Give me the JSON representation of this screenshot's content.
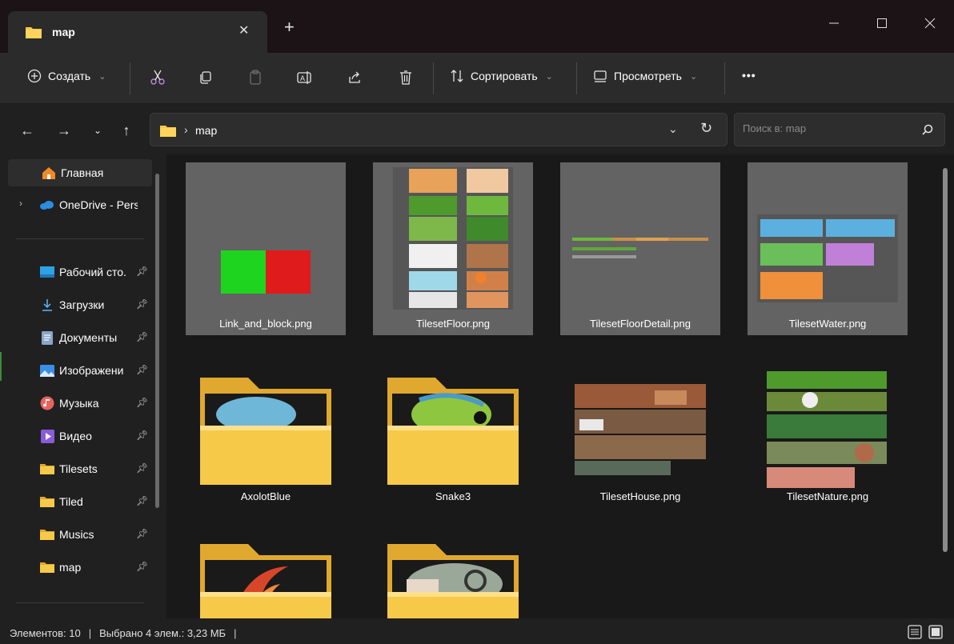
{
  "window": {
    "tab_title": "map",
    "tab_close_icon": "close-icon",
    "new_tab_symbol": "+",
    "controls": [
      "minimize",
      "maximize",
      "close"
    ]
  },
  "toolbar": {
    "create_label": "Создать",
    "sort_label": "Сортировать",
    "view_label": "Просмотреть",
    "more_label": "•••",
    "icons": [
      "cut-icon",
      "copy-icon",
      "paste-icon",
      "rename-icon",
      "share-icon",
      "delete-icon"
    ]
  },
  "address": {
    "crumb": "map",
    "separator": "›"
  },
  "search": {
    "placeholder": "Поиск в: map"
  },
  "sidebar": {
    "items": [
      {
        "label": "Главная",
        "icon": "home-icon",
        "pinned": false
      },
      {
        "label": "OneDrive - Persc",
        "icon": "onedrive-icon",
        "pinned": false
      },
      {
        "label": "Рабочий сто.",
        "icon": "desktop-icon",
        "pinned": true
      },
      {
        "label": "Загрузки",
        "icon": "download-icon",
        "pinned": true
      },
      {
        "label": "Документы",
        "icon": "documents-icon",
        "pinned": true
      },
      {
        "label": "Изображени",
        "icon": "pictures-icon",
        "pinned": true
      },
      {
        "label": "Музыка",
        "icon": "music-icon",
        "pinned": true
      },
      {
        "label": "Видео",
        "icon": "video-icon",
        "pinned": true
      },
      {
        "label": "Tilesets",
        "icon": "folder-icon",
        "pinned": true
      },
      {
        "label": "Tiled",
        "icon": "folder-icon",
        "pinned": true
      },
      {
        "label": "Musics",
        "icon": "folder-icon",
        "pinned": true
      },
      {
        "label": "map",
        "icon": "folder-icon",
        "pinned": true
      }
    ]
  },
  "files": [
    {
      "name": "Link_and_block.png",
      "kind": "image",
      "selected": true
    },
    {
      "name": "TilesetFloor.png",
      "kind": "image",
      "selected": true
    },
    {
      "name": "TilesetFloorDetail.png",
      "kind": "image",
      "selected": true
    },
    {
      "name": "TilesetWater.png",
      "kind": "image",
      "selected": true
    },
    {
      "name": "AxolotBlue",
      "kind": "folder",
      "selected": false
    },
    {
      "name": "Snake3",
      "kind": "folder",
      "selected": false
    },
    {
      "name": "TilesetHouse.png",
      "kind": "image",
      "selected": false
    },
    {
      "name": "TilesetNature.png",
      "kind": "image",
      "selected": false
    },
    {
      "name": "",
      "kind": "folder",
      "selected": false
    },
    {
      "name": "",
      "kind": "folder",
      "selected": false
    }
  ],
  "status": {
    "items_count": "Элементов: 10",
    "selected_info": "Выбрано 4 элем.: 3,23 МБ"
  },
  "colors": {
    "folder_yellow": "#f7c948",
    "folder_dark": "#e0a82e",
    "selection_gray": "#636363",
    "accent_blue": "#2b8de0",
    "thumb_green": "#1fd41f",
    "thumb_red": "#e01b1b"
  }
}
